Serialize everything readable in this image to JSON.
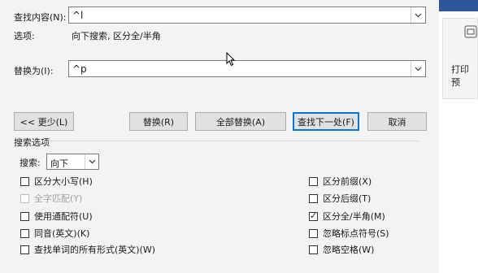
{
  "find": {
    "label": "查找内容(N):",
    "value": "^l"
  },
  "options_line": {
    "label": "选项:",
    "value": "向下搜索, 区分全/半角"
  },
  "replace": {
    "label": "替换为(I):",
    "value": "^p"
  },
  "buttons": {
    "less": "<< 更少(L)",
    "replace": "替换(R)",
    "replace_all": "全部替换(A)",
    "find_next": "查找下一处(F)",
    "cancel": "取消"
  },
  "search_options": {
    "title": "搜索选项",
    "search_label": "搜索:",
    "search_value": "向下"
  },
  "left_options": [
    {
      "label": "区分大小写(H)",
      "checked": false,
      "disabled": false
    },
    {
      "label": "全字匹配(Y)",
      "checked": false,
      "disabled": true
    },
    {
      "label": "使用通配符(U)",
      "checked": false,
      "disabled": false
    },
    {
      "label": "同音(英文)(K)",
      "checked": false,
      "disabled": false
    },
    {
      "label": "查找单词的所有形式(英文)(W)",
      "checked": false,
      "disabled": false
    }
  ],
  "right_options": [
    {
      "label": "区分前缀(X)",
      "checked": false,
      "disabled": false
    },
    {
      "label": "区分后缀(T)",
      "checked": false,
      "disabled": false
    },
    {
      "label": "区分全/半角(M)",
      "checked": true,
      "disabled": false
    },
    {
      "label": "忽略标点符号(S)",
      "checked": false,
      "disabled": false
    },
    {
      "label": "忽略空格(W)",
      "checked": false,
      "disabled": false
    }
  ],
  "side_panel": {
    "label": "打印预"
  },
  "colors": {
    "accent": "#0078d7",
    "ribbon": "#2b579a"
  }
}
